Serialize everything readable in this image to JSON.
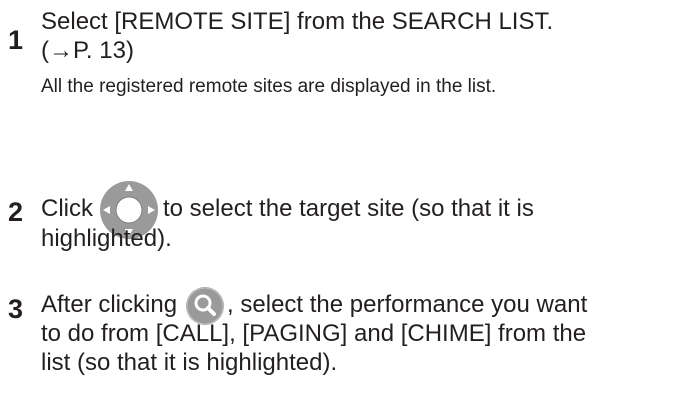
{
  "steps": [
    {
      "number": "1",
      "lines": [
        "Select [REMOTE SITE] from the SEARCH LIST.",
        "(→P. 13)"
      ],
      "note": "All the registered remote sites are displayed in the list."
    },
    {
      "number": "2",
      "line1_before": "Click",
      "line1_icon": "directional-pad-icon",
      "line1_after": "to select the target site (so that it is",
      "line2": "highlighted)."
    },
    {
      "number": "3",
      "line1_before": "After clicking",
      "line1_icon": "search-magnifier-icon",
      "line1_after": ", select the performance you want",
      "line2": "to do from [CALL], [PAGING] and [CHIME] from the",
      "line3": "list (so that it is highlighted)."
    }
  ],
  "colors": {
    "text": "#231f20",
    "icon_gray": "#9a9a9a",
    "icon_white": "#ffffff"
  }
}
